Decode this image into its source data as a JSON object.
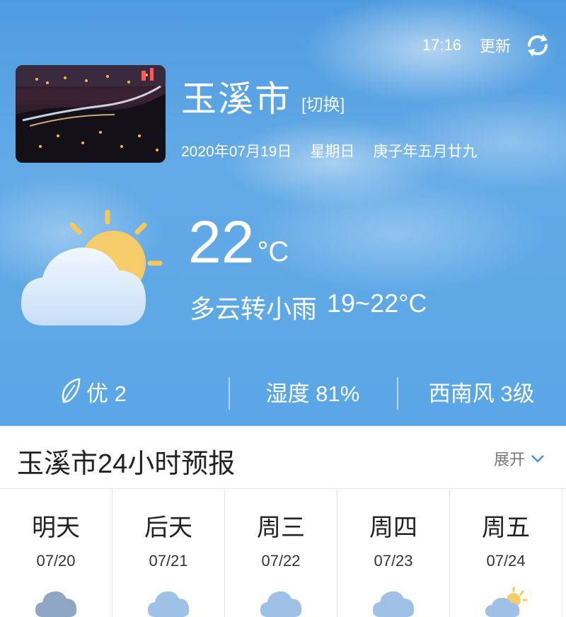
{
  "header": {
    "time": "17:16",
    "update_label": "更新"
  },
  "city": {
    "name": "玉溪市",
    "switch_label": "[切换]"
  },
  "date": {
    "gregorian": "2020年07月19日",
    "weekday": "星期日",
    "lunar": "庚子年五月廿九"
  },
  "current": {
    "temp": "22",
    "unit": "°C",
    "condition": "多云转小雨",
    "range": "19~22°C"
  },
  "stats": {
    "air_quality": "优 2",
    "humidity": "湿度 81%",
    "wind": "西南风 3级"
  },
  "forecast": {
    "title": "玉溪市24小时预报",
    "expand_label": "展开",
    "days": [
      {
        "name": "明天",
        "date": "07/20",
        "icon": "cloud-dark-icon"
      },
      {
        "name": "后天",
        "date": "07/21",
        "icon": "cloud-icon"
      },
      {
        "name": "周三",
        "date": "07/22",
        "icon": "cloud-icon"
      },
      {
        "name": "周四",
        "date": "07/23",
        "icon": "cloud-icon"
      },
      {
        "name": "周五",
        "date": "07/24",
        "icon": "partly-cloudy-icon"
      }
    ]
  },
  "colors": {
    "sky": "#5aa6e6",
    "cloud_icon": "#9fc1e8",
    "sun": "#f6c85a"
  }
}
